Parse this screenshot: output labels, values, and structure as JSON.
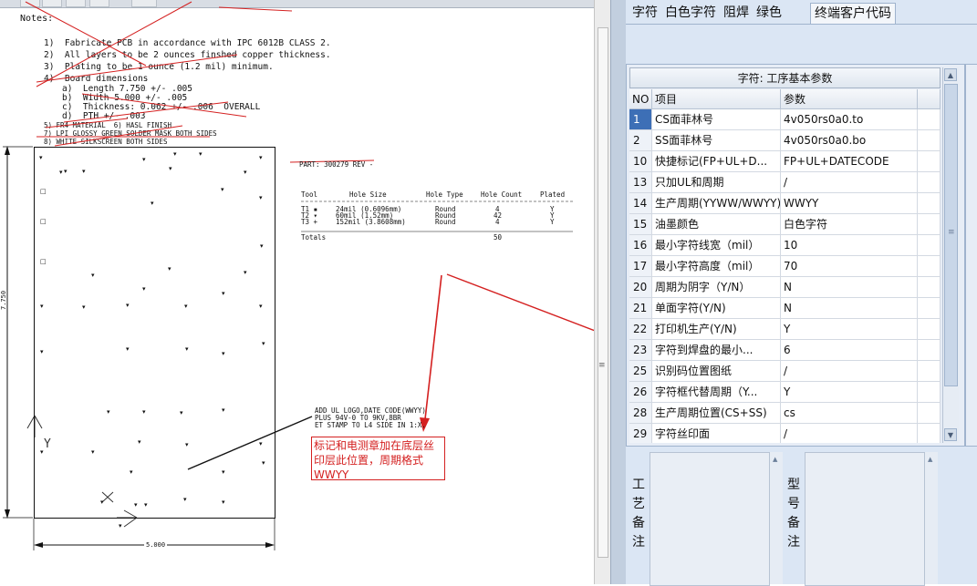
{
  "left": {
    "notes_title": "Notes:",
    "notes": [
      "1)  Fabricate PCB in accordance with IPC 6012B CLASS 2.",
      "2)  All layers to be 2 ounces finshed copper thickness.",
      "3)  Plating to be 1 ounce (1.2 mil) minimum.",
      "4)  Board dimensions",
      "a)  Length 7.750 +/- .005",
      "b)  Width 5.000 +/- .005",
      "c)  Thickness: 0.062 +/- .006  OVERALL",
      "d)  PTH +/- .003",
      "5) FR4 MATERIAL  6) HASL FINISH",
      "7) LPI GLOSSY GREEN SOLDER MASK BOTH SIDES",
      "8) WHITE SILKSCREEN BOTH SIDES"
    ],
    "part_label": "PART: 300279 REV -",
    "drill_table": {
      "headers": [
        "Tool",
        "Hole Size",
        "Hole Type",
        "Hole Count",
        "Plated"
      ],
      "rows": [
        [
          "T1 ▪",
          "24mil (0.6096mm)",
          "Round",
          "4",
          "Y"
        ],
        [
          "T2 ▾",
          "60mil (1.52mm)",
          "Round",
          "42",
          "Y"
        ],
        [
          "T3 +",
          "152mil (3.8608mm)",
          "Round",
          "4",
          "Y"
        ]
      ],
      "totals_label": "Totals",
      "totals_value": "50"
    },
    "dim_height": "7.750",
    "dim_width": "5.000",
    "axis_y": "Y",
    "axis_x": "X",
    "ul_note": [
      "ADD UL LOGO,DATE CODE(WWYY)",
      "PLUS 94V-0 TO 9KV,8BR",
      "ET STAMP TO L4 SIDE IN 1:X."
    ],
    "comment": "标记和电测章加在底层丝印层此位置，周期格式WWYY",
    "comment_color": "#d42020"
  },
  "right": {
    "tabs": [
      "字符",
      "白色字符",
      "阻焊",
      "绿色",
      "终端客户代码"
    ],
    "active_tab": "终端客户代码",
    "grid_title": "字符: 工序基本参数",
    "columns": [
      "NO",
      "项目",
      "参数"
    ],
    "rows": [
      {
        "no": "1",
        "item": "CS面菲林号",
        "value": "4v050rs0a0.to"
      },
      {
        "no": "2",
        "item": "SS面菲林号",
        "value": "4v050rs0a0.bo"
      },
      {
        "no": "10",
        "item": "快捷标记(FP+UL+D...",
        "value": "FP+UL+DATECODE"
      },
      {
        "no": "13",
        "item": "只加UL和周期",
        "value": "/"
      },
      {
        "no": "14",
        "item": "生产周期(YYWW/WWYY)",
        "value": "WWYY"
      },
      {
        "no": "15",
        "item": "油墨颜色",
        "value": "白色字符"
      },
      {
        "no": "16",
        "item": "最小字符线宽（mil）",
        "value": "10"
      },
      {
        "no": "17",
        "item": "最小字符高度（mil）",
        "value": "70"
      },
      {
        "no": "20",
        "item": "周期为阴字（Y/N）",
        "value": "N"
      },
      {
        "no": "21",
        "item": "单面字符(Y/N)",
        "value": "N"
      },
      {
        "no": "22",
        "item": "打印机生产(Y/N)",
        "value": "Y"
      },
      {
        "no": "23",
        "item": "字符到焊盘的最小...",
        "value": "6"
      },
      {
        "no": "25",
        "item": "识别码位置图纸",
        "value": "/"
      },
      {
        "no": "26",
        "item": "字符框代替周期（Y...",
        "value": "Y"
      },
      {
        "no": "28",
        "item": "生产周期位置(CS+SS)",
        "value": "cs"
      },
      {
        "no": "29",
        "item": "字符丝印面",
        "value": "/"
      }
    ],
    "selected_row": "1",
    "memo_left_label": "工艺备注",
    "memo_right_label": "型号备注"
  }
}
